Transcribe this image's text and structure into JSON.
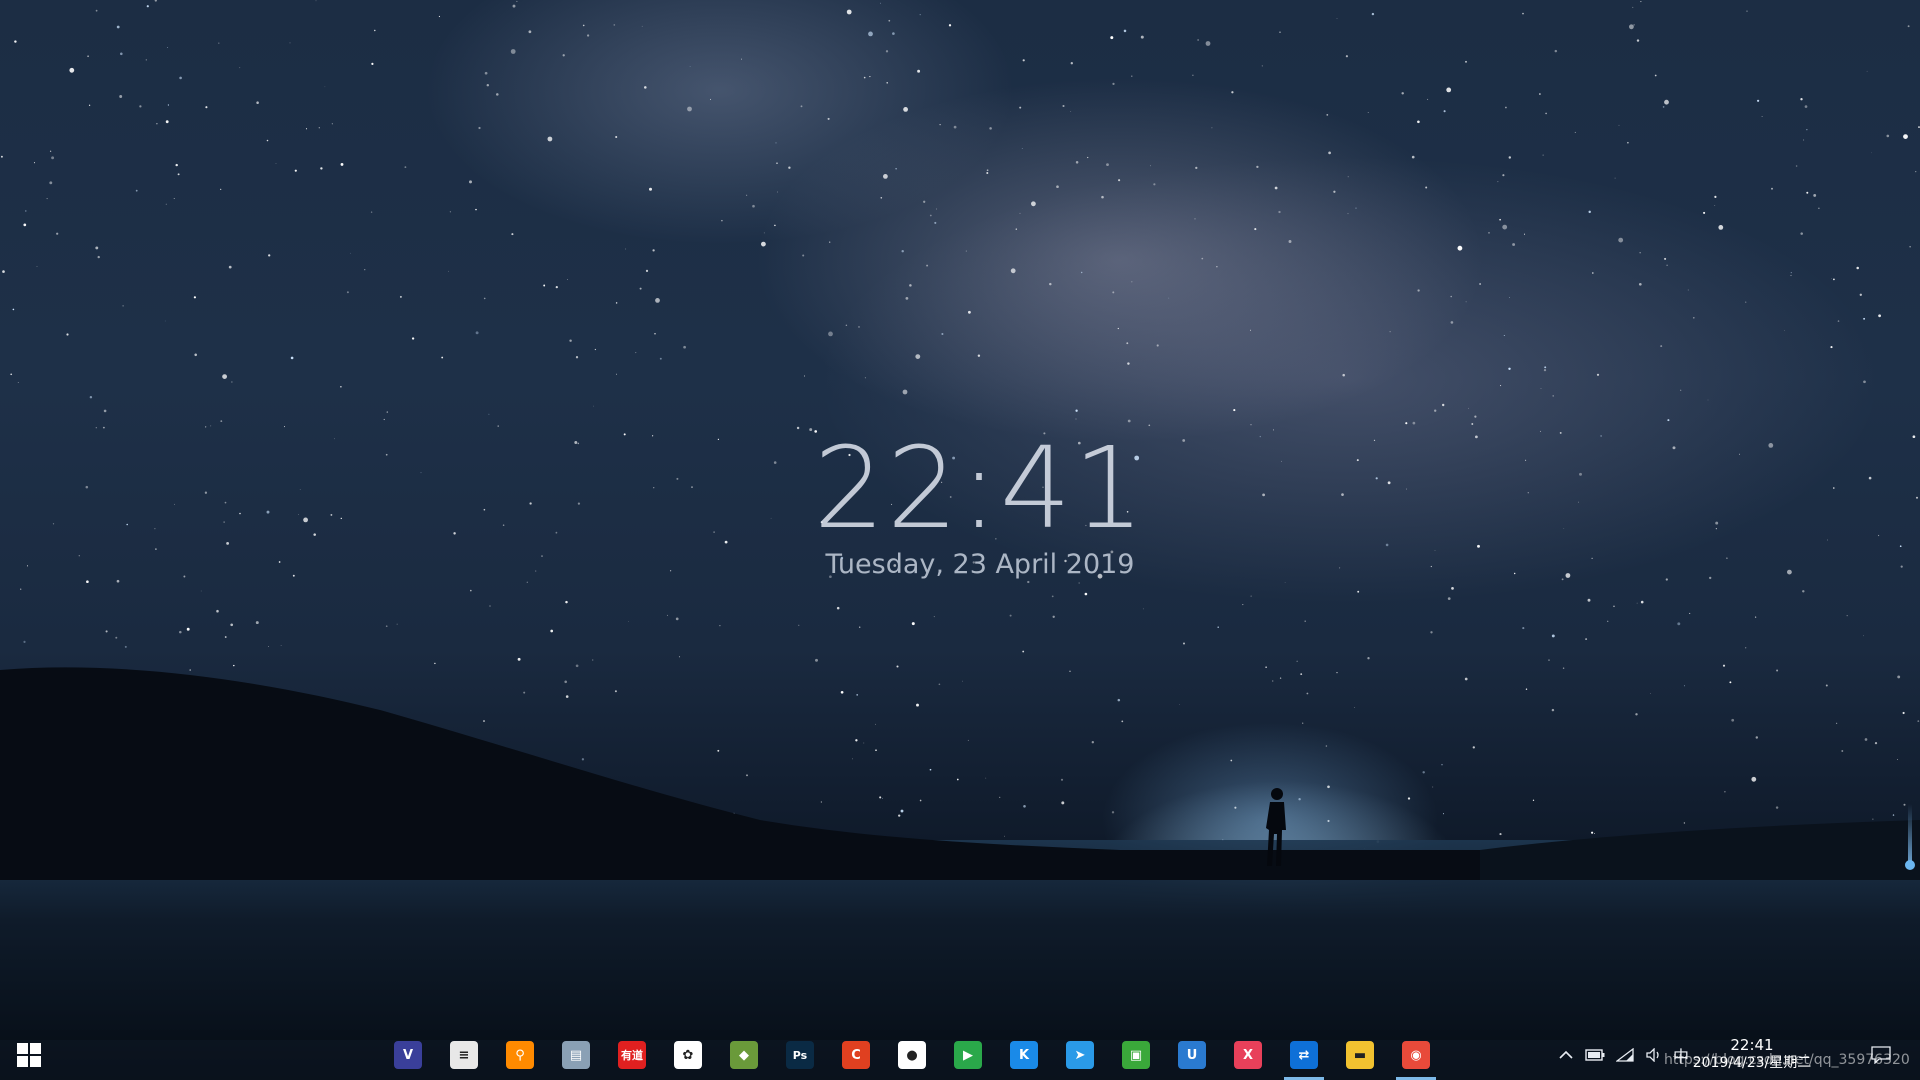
{
  "clock_widget": {
    "time": "22:41",
    "date": "Tuesday, 23 April 2019"
  },
  "taskbar": {
    "start_icon": "windows-start-icon",
    "apps": [
      {
        "name": "visual-studio",
        "icon": "visual-studio-icon",
        "glyph": "V",
        "color": "#3a3f9a",
        "active": false
      },
      {
        "name": "news-reader",
        "icon": "newspaper-icon",
        "glyph": "≡",
        "color": "#e8e8e8",
        "active": false
      },
      {
        "name": "search-tool",
        "icon": "magnifier-icon",
        "glyph": "⚲",
        "color": "#ff8a00",
        "active": false
      },
      {
        "name": "database-tool",
        "icon": "database-icon",
        "glyph": "▤",
        "color": "#8aa0b5",
        "active": false
      },
      {
        "name": "youdao-dictionary",
        "icon": "youdao-icon",
        "glyph": "有道",
        "color": "#e02020",
        "active": false
      },
      {
        "name": "baidu-netdisk",
        "icon": "cloud-rings-icon",
        "glyph": "✿",
        "color": "#ffffff",
        "active": false
      },
      {
        "name": "git-client",
        "icon": "git-icon",
        "glyph": "◆",
        "color": "#6a9a3a",
        "active": false
      },
      {
        "name": "photoshop",
        "icon": "photoshop-icon",
        "glyph": "Ps",
        "color": "#0a2a44",
        "active": false
      },
      {
        "name": "ccleaner",
        "icon": "ccleaner-icon",
        "glyph": "C",
        "color": "#e04020",
        "active": false
      },
      {
        "name": "wechat",
        "icon": "wechat-icon",
        "glyph": "●",
        "color": "#ffffff",
        "active": false
      },
      {
        "name": "media-player",
        "icon": "play-icon",
        "glyph": "▶",
        "color": "#2aa84a",
        "active": false
      },
      {
        "name": "kugou-music",
        "icon": "kugou-icon",
        "glyph": "K",
        "color": "#1a8ae8",
        "active": false
      },
      {
        "name": "feishu-messenger",
        "icon": "paper-plane-icon",
        "glyph": "➤",
        "color": "#2a9ae8",
        "active": false
      },
      {
        "name": "green-app",
        "icon": "green-folder-icon",
        "glyph": "▣",
        "color": "#3aa83a",
        "active": false
      },
      {
        "name": "u-tool",
        "icon": "u-shield-icon",
        "glyph": "U",
        "color": "#2a7ad0",
        "active": false
      },
      {
        "name": "xmind",
        "icon": "xmind-icon",
        "glyph": "X",
        "color": "#e8405a",
        "active": false
      },
      {
        "name": "teamviewer",
        "icon": "teamviewer-icon",
        "glyph": "⇄",
        "color": "#0e70d8",
        "active": true
      },
      {
        "name": "file-explorer",
        "icon": "folder-icon",
        "glyph": "▬",
        "color": "#f2c230",
        "active": false
      },
      {
        "name": "chrome",
        "icon": "chrome-icon",
        "glyph": "◉",
        "color": "#e84a3a",
        "active": true
      }
    ],
    "tray": {
      "chevron_icon": "chevron-up-icon",
      "battery_icon": "battery-icon",
      "wifi_icon": "wifi-icon",
      "volume_icon": "volume-icon",
      "ime_label": "中",
      "time": "22:41",
      "date": "2019/4/23/星期二",
      "notification_icon": "notification-icon"
    }
  },
  "watermark": "https://blog.csdn.net/qq_35976320"
}
